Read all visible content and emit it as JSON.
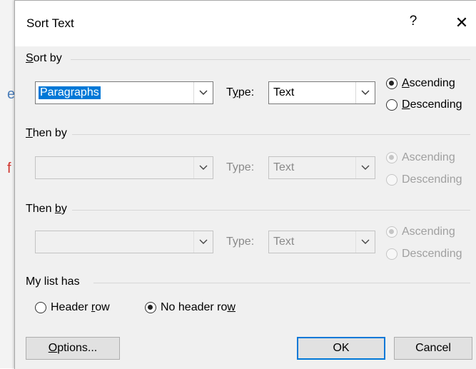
{
  "background": {
    "fragments": [
      "e",
      "f"
    ]
  },
  "dialog": {
    "title": "Sort Text",
    "help_glyph": "?",
    "close_glyph": "✕"
  },
  "sort_by": {
    "label_pre": "",
    "label_mn": "S",
    "label_post": "ort by",
    "column_value": "Paragraphs",
    "type_label_pre": "T",
    "type_label_mn": "y",
    "type_label_post": "pe:",
    "type_value": "Text",
    "ascending_pre": "",
    "ascending_mn": "A",
    "ascending_post": "scending",
    "descending_pre": "",
    "descending_mn": "D",
    "descending_post": "escending",
    "order": "Ascending"
  },
  "then_by_1": {
    "label_pre": "",
    "label_mn": "T",
    "label_post": "hen by",
    "column_value": "",
    "type_label": "Type:",
    "type_value": "Text",
    "ascending": "Ascending",
    "descending": "Descending",
    "order": "Ascending",
    "disabled": true
  },
  "then_by_2": {
    "label_pre": "Then ",
    "label_mn": "b",
    "label_post": "y",
    "column_value": "",
    "type_label": "Type:",
    "type_value": "Text",
    "ascending": "Ascending",
    "descending": "Descending",
    "order": "Ascending",
    "disabled": true
  },
  "list_has": {
    "label": "My list has",
    "header_row_pre": "Header ",
    "header_row_mn": "r",
    "header_row_post": "ow",
    "no_header_row_pre": "No header ro",
    "no_header_row_mn": "w",
    "no_header_row_post": "",
    "selected": "No header row"
  },
  "buttons": {
    "options_pre": "",
    "options_mn": "O",
    "options_post": "ptions...",
    "ok": "OK",
    "cancel": "Cancel"
  },
  "colors": {
    "selection": "#0078d7",
    "dialog_bg": "#f0f0f0",
    "doc_text_blue": "#4a7db9",
    "doc_text_red": "#d0342c"
  },
  "icons": [
    "chevron-down-icon",
    "radio-button-icon",
    "close-icon",
    "help-icon"
  ]
}
